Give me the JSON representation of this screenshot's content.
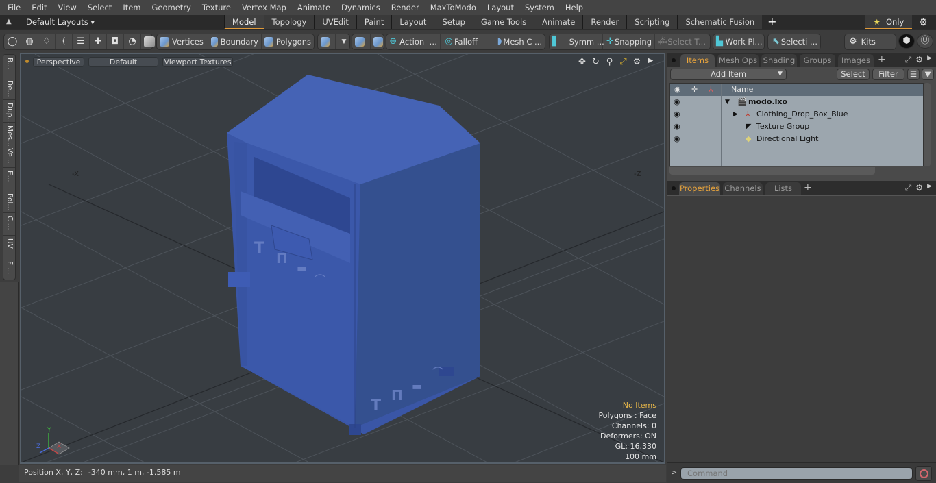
{
  "menu": [
    "File",
    "Edit",
    "View",
    "Select",
    "Item",
    "Geometry",
    "Texture",
    "Vertex Map",
    "Animate",
    "Dynamics",
    "Render",
    "MaxToModo",
    "Layout",
    "System",
    "Help"
  ],
  "layoutbar": {
    "layouts_label": "Default Layouts",
    "tabs": [
      "Model",
      "Topology",
      "UVEdit",
      "Paint",
      "Layout",
      "Setup",
      "Game Tools",
      "Animate",
      "Render",
      "Scripting",
      "Schematic Fusion"
    ],
    "active_tab": "Model",
    "add_tab": "+",
    "only_label": "Only"
  },
  "toolbar": {
    "vertices": "Vertices",
    "boundary": "Boundary",
    "polygons": "Polygons",
    "action": "Action",
    "falloff": "Falloff",
    "mesh": "Mesh C ...",
    "symm": "Symm ...",
    "snapping": "Snapping",
    "select_t": "Select T...",
    "work_plane": "Work Pl...",
    "selection": "Selecti ...",
    "kits": "Kits"
  },
  "left_tabs": [
    "B...",
    "De...",
    "Dup...",
    "Mes...",
    "Ve...",
    "E...",
    "Pol...",
    "C ...",
    "UV",
    "F ..."
  ],
  "viewport": {
    "view_mode": "Perspective",
    "shading": "Default",
    "textures": "Viewport Textures",
    "axis_neg_x": "-X",
    "axis_neg_z": "-Z",
    "gizmo": {
      "x": "X",
      "y": "Y",
      "z": "Z"
    },
    "info": {
      "selection": "No Items",
      "polygons": "Polygons : Face",
      "channels": "Channels: 0",
      "deformers": "Deformers: ON",
      "gl": "GL: 16,330",
      "grid": "100 mm"
    },
    "colors": {
      "model": "#3a56a6",
      "background": "#383d42"
    }
  },
  "status": {
    "label": "Position X, Y, Z:",
    "value": "-340 mm, 1 m, -1.585 m"
  },
  "items_panel": {
    "tabs": [
      "Items",
      "Mesh Ops",
      "Shading",
      "Groups",
      "Images"
    ],
    "active_tab": "Items",
    "add_item": "Add Item",
    "select": "Select",
    "filter": "Filter",
    "column_name": "Name",
    "tree": [
      {
        "name": "modo.lxo",
        "level": 0,
        "bold": true,
        "icon": "scene-icon"
      },
      {
        "name": "Clothing_Drop_Box_Blue",
        "level": 1,
        "bold": false,
        "icon": "mesh-locator-icon"
      },
      {
        "name": "Texture Group",
        "level": 1,
        "bold": false,
        "icon": "texture-group-icon"
      },
      {
        "name": "Directional Light",
        "level": 1,
        "bold": false,
        "icon": "light-icon"
      }
    ]
  },
  "properties_panel": {
    "tabs": [
      "Properties",
      "Channels",
      "Lists"
    ],
    "active_tab": "Properties"
  },
  "command": {
    "prompt": ">",
    "placeholder": "Command"
  }
}
